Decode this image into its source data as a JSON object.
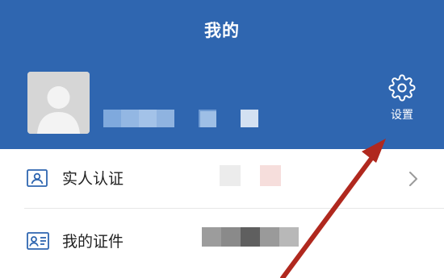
{
  "header": {
    "title": "我的"
  },
  "settings": {
    "label": "设置",
    "icon": "gear-icon"
  },
  "rows": [
    {
      "label": "实人认证",
      "icon": "id-card-person-icon",
      "chevron": true
    },
    {
      "label": "我的证件",
      "icon": "id-card-list-icon",
      "chevron": false
    }
  ],
  "colors": {
    "header": "#2f66b0",
    "arrow": "#b0281e"
  }
}
